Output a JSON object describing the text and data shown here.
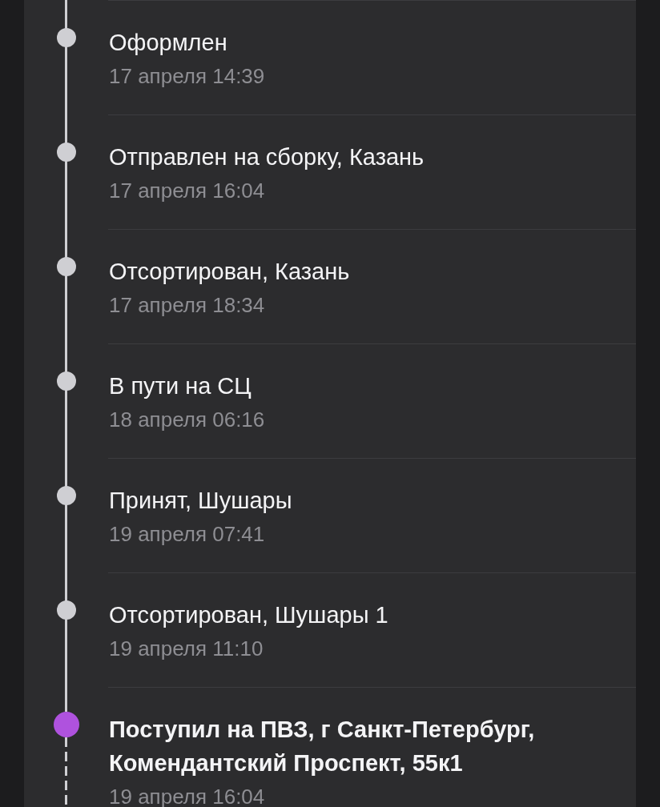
{
  "tracking": {
    "events": [
      {
        "title": "Оформлен",
        "time": "17 апреля 14:39",
        "current": false
      },
      {
        "title": "Отправлен на сборку, Казань",
        "time": "17 апреля 16:04",
        "current": false
      },
      {
        "title": "Отсортирован, Казань",
        "time": "17 апреля 18:34",
        "current": false
      },
      {
        "title": "В пути на СЦ",
        "time": "18 апреля 06:16",
        "current": false
      },
      {
        "title": "Принят, Шушары",
        "time": "19 апреля 07:41",
        "current": false
      },
      {
        "title": "Отсортирован, Шушары 1",
        "time": "19 апреля 11:10",
        "current": false
      },
      {
        "title": "Поступил на ПВЗ, г Санкт-Петербург, Комендантский Проспект, 55к1",
        "time": "19 апреля 16:04",
        "current": true
      }
    ]
  }
}
